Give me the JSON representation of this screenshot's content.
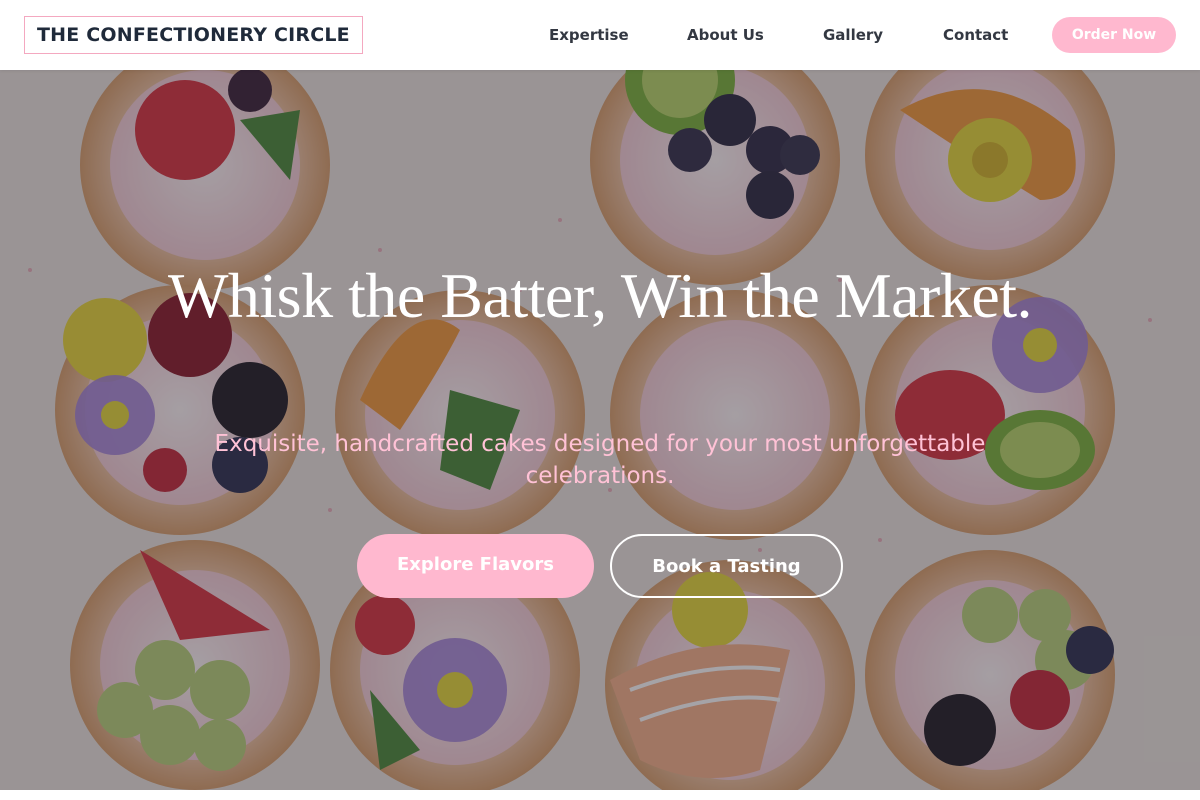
{
  "header": {
    "logo_text": "THE CONFECTIONERY CIRCLE",
    "nav": [
      {
        "label": "Expertise"
      },
      {
        "label": "About Us"
      },
      {
        "label": "Gallery"
      },
      {
        "label": "Contact"
      }
    ],
    "cta_label": "Order Now"
  },
  "hero": {
    "title": "Whisk the Batter, Win the Market.",
    "subtitle": "Exquisite, handcrafted cakes designed for your most unforgettable celebrations.",
    "primary_button": "Explore Flavors",
    "secondary_button": "Book a Tasting",
    "background_image": "overhead-photo-of-fruit-topped-cookies-with-cream-and-flowers"
  },
  "colors": {
    "accent_pink": "#ffb8cf",
    "subtitle_pink": "#ffc2d6",
    "logo_text": "#1f2a3a",
    "nav_text": "#333842"
  }
}
